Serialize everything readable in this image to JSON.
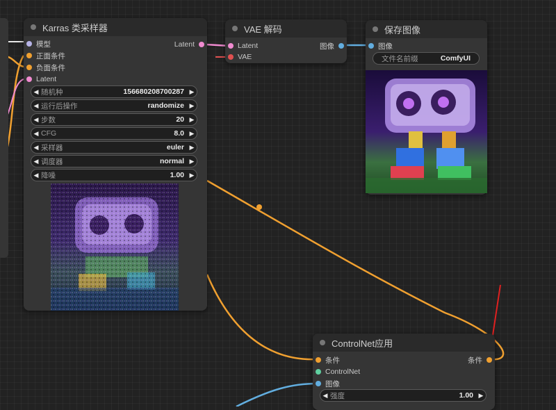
{
  "sampler": {
    "title": "Karras 类采样器",
    "inputs": {
      "model": "模型",
      "positive": "正面条件",
      "negative": "负面条件",
      "latent": "Latent"
    },
    "output": "Latent",
    "widgets": [
      {
        "label": "随机种",
        "value": "156680208700287"
      },
      {
        "label": "运行后操作",
        "value": "randomize"
      },
      {
        "label": "步数",
        "value": "20"
      },
      {
        "label": "CFG",
        "value": "8.0"
      },
      {
        "label": "采样器",
        "value": "euler"
      },
      {
        "label": "调度器",
        "value": "normal"
      },
      {
        "label": "降噪",
        "value": "1.00"
      }
    ]
  },
  "vae": {
    "title": "VAE 解码",
    "inputs": {
      "latent": "Latent",
      "vae": "VAE"
    },
    "output": "图像"
  },
  "save": {
    "title": "保存图像",
    "input": "图像",
    "widget": {
      "label": "文件名前缀",
      "value": "ComfyUI"
    }
  },
  "controlnet": {
    "title": "ControlNet应用",
    "inputs": {
      "cond": "条件",
      "controlnet": "ControlNet",
      "image": "图像"
    },
    "output": "条件",
    "widget": {
      "label": "强度",
      "value": "1.00"
    }
  },
  "colors": {
    "wire_conditioning": "#f0a030",
    "wire_latent": "#f08bd0",
    "wire_vae": "#e05050",
    "wire_image": "#62aee0",
    "annotation_arrow": "#e02020"
  }
}
